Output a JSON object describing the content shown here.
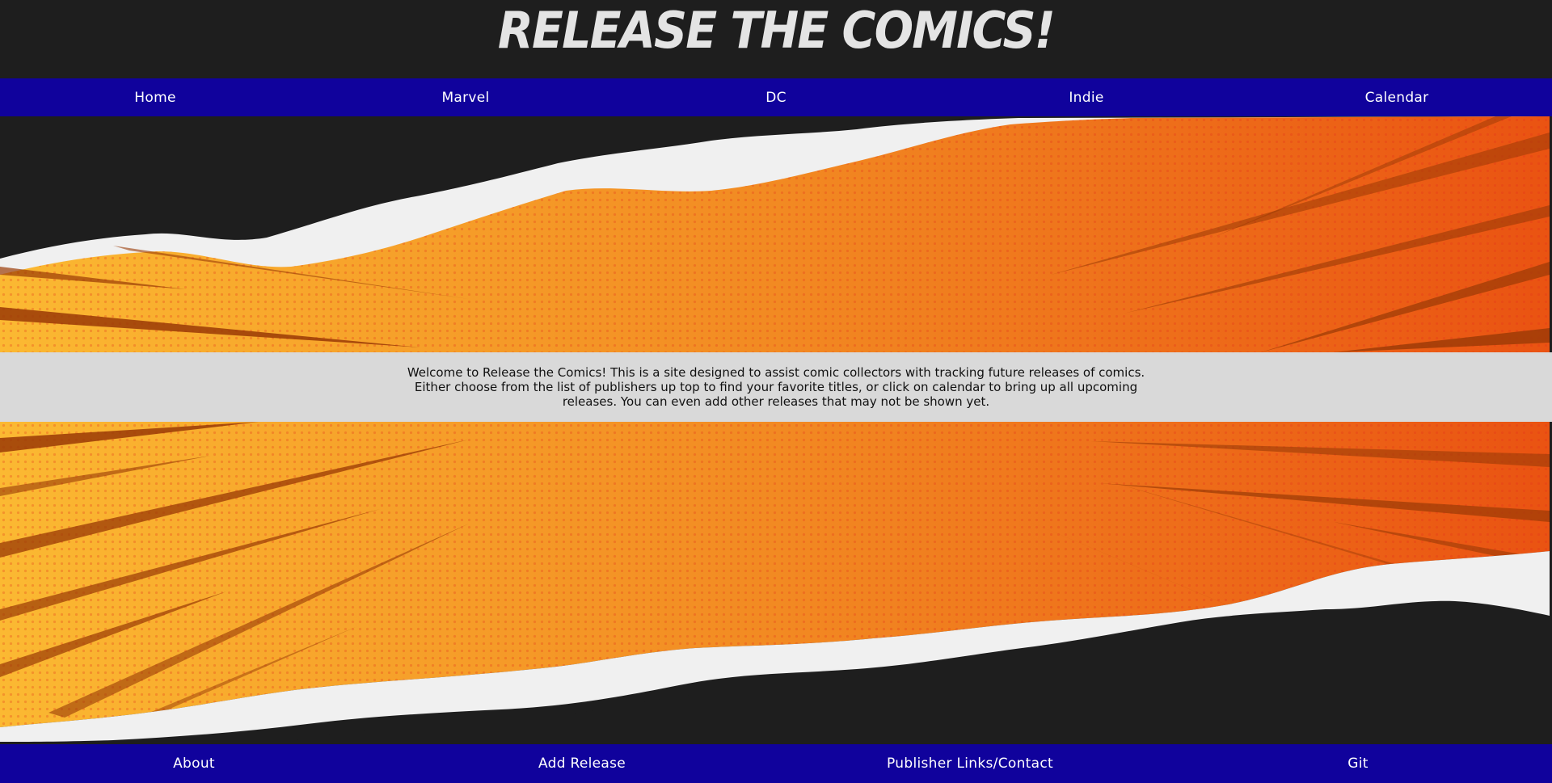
{
  "header": {
    "title": "Release the Comics!"
  },
  "top_nav": {
    "items": [
      {
        "label": "Home"
      },
      {
        "label": "Marvel"
      },
      {
        "label": "DC"
      },
      {
        "label": "Indie"
      },
      {
        "label": "Calendar"
      }
    ]
  },
  "intro": {
    "text": "Welcome to Release the Comics! This is a site designed to assist comic collectors with tracking future releases of comics. Either choose from the list of publishers up top to find your favorite titles, or click on calendar to bring up all upcoming releases. You can even add other releases that may not be shown yet."
  },
  "bottom_nav": {
    "items": [
      {
        "label": "About"
      },
      {
        "label": "Add Release"
      },
      {
        "label": "Publisher Links/Contact"
      },
      {
        "label": "Git"
      }
    ]
  },
  "colors": {
    "background": "#1e1e1e",
    "nav": "#10029c",
    "intro_band": "#d9d9d9",
    "burst_light": "#fbb932",
    "burst_dark": "#ea5312",
    "torn_paper": "#f0f0f0"
  }
}
